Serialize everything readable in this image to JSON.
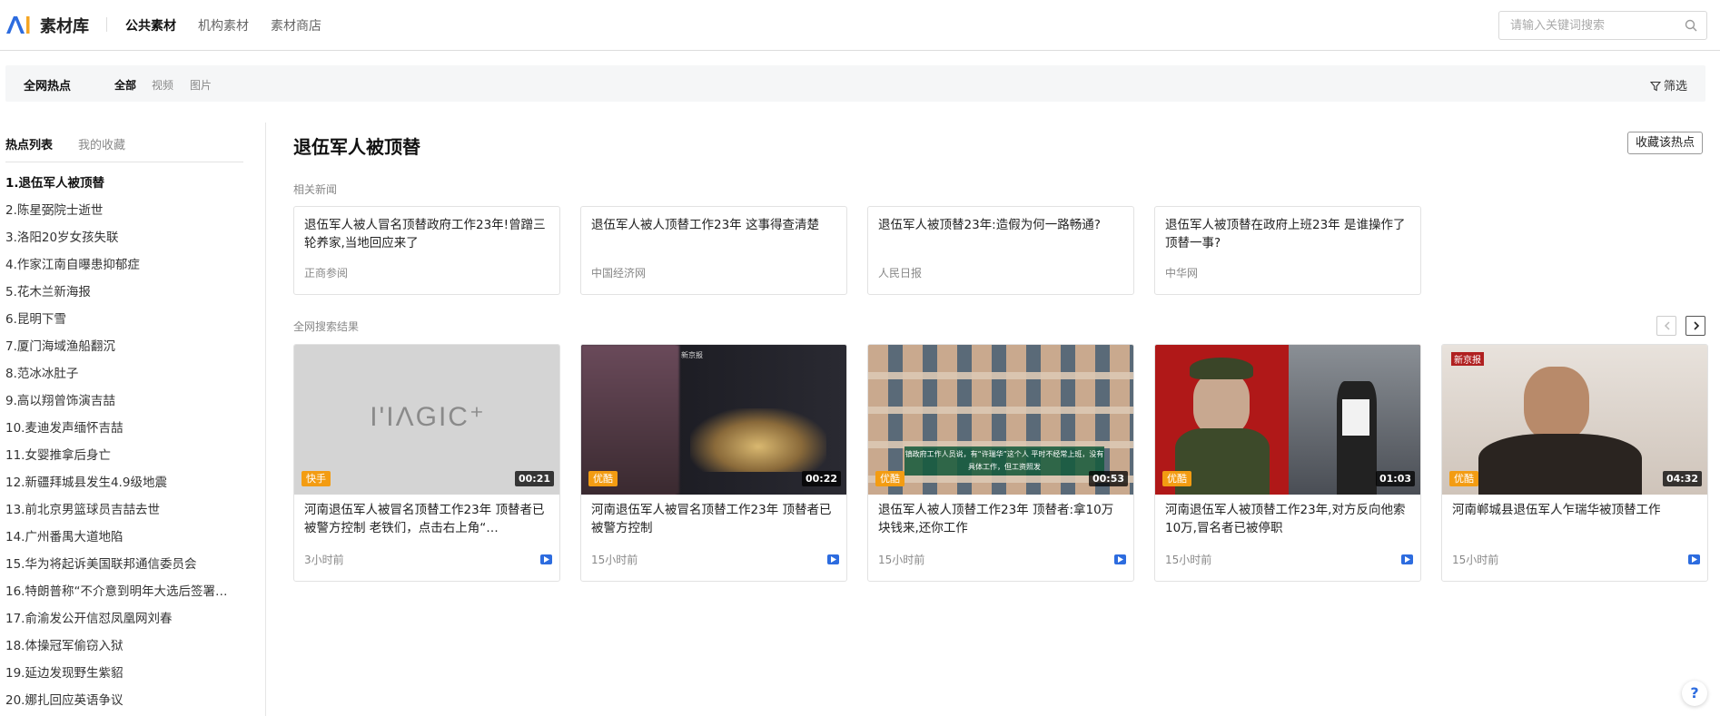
{
  "header": {
    "brand": "素材库",
    "nav": [
      {
        "label": "公共素材",
        "active": true
      },
      {
        "label": "机构素材",
        "active": false
      },
      {
        "label": "素材商店",
        "active": false
      }
    ],
    "search_placeholder": "请输入关键词搜索"
  },
  "filterbar": {
    "title": "全网热点",
    "tabs": [
      {
        "label": "全部",
        "active": true
      },
      {
        "label": "视频",
        "active": false
      },
      {
        "label": "图片",
        "active": false
      }
    ],
    "filter_label": "筛选"
  },
  "sidebar": {
    "tabs": [
      {
        "label": "热点列表",
        "active": true
      },
      {
        "label": "我的收藏",
        "active": false
      }
    ],
    "items": [
      "1.退伍军人被顶替",
      "2.陈星弼院士逝世",
      "3.洛阳20岁女孩失联",
      "4.作家江南自曝患抑郁症",
      "5.花木兰新海报",
      "6.昆明下雪",
      "7.厦门海域渔船翻沉",
      "8.范冰冰肚子",
      "9.高以翔曾饰演吉喆",
      "10.麦迪发声缅怀吉喆",
      "11.女婴推拿后身亡",
      "12.新疆拜城县发生4.9级地震",
      "13.前北京男篮球员吉喆去世",
      "14.广州番禺大道地陷",
      "15.华为将起诉美国联邦通信委员会",
      "16.特朗普称“不介意到明年大选后签署…",
      "17.俞渝发公开信怼凤凰网刘春",
      "18.体操冠军偷窃入狱",
      "19.延边发现野生紫貂",
      "20.娜扎回应英语争议"
    ]
  },
  "main": {
    "title": "退伍军人被顶替",
    "collect_label": "收藏该热点",
    "related_label": "相关新闻",
    "search_label": "全网搜索结果",
    "news": [
      {
        "title": "退伍军人被人冒名顶替政府工作23年!曾蹭三轮养家,当地回应来了",
        "source": "正商参阅"
      },
      {
        "title": "退伍军人被人顶替工作23年 这事得查清楚",
        "source": "中国经济网"
      },
      {
        "title": "退伍军人被顶替23年:造假为何一路畅通?",
        "source": "人民日报"
      },
      {
        "title": "退伍军人被顶替在政府上班23年 是谁操作了顶替一事?",
        "source": "中华网"
      }
    ],
    "videos": [
      {
        "title": "河南退伍军人被冒名顶替工作23年 顶替者已被警方控制 老铁们，点击右上角“…",
        "platform": "快手",
        "duration": "00:21",
        "time": "3小时前",
        "thumb_text": "I'IΛGIC⁺"
      },
      {
        "title": "河南退伍军人被冒名顶替工作23年 顶替者已被警方控制",
        "platform": "优酷",
        "duration": "00:22",
        "time": "15小时前",
        "thumb_text": "新京报"
      },
      {
        "title": "退伍军人被人顶替工作23年 顶替者:拿10万块钱来,还你工作",
        "platform": "优酷",
        "duration": "00:53",
        "time": "15小时前",
        "thumb_text": "镇政府工作人员说，有“许瑞华”这个人 平时不经常上班，没有具体工作，但工资照发"
      },
      {
        "title": "河南退伍军人被顶替工作23年,对方反向他索10万,冒名者已被停职",
        "platform": "优酷",
        "duration": "01:03",
        "time": "15小时前",
        "thumb_text": ""
      },
      {
        "title": "河南郸城县退伍军人乍瑞华被顶替工作",
        "platform": "优酷",
        "duration": "04:32",
        "time": "15小时前",
        "thumb_text": "新京报"
      }
    ]
  },
  "colors": {
    "platform_badge": "#f39c12",
    "video_icon": "#2d6cdf",
    "logo_blue": "#2d6cdf",
    "logo_orange": "#f5a623"
  }
}
